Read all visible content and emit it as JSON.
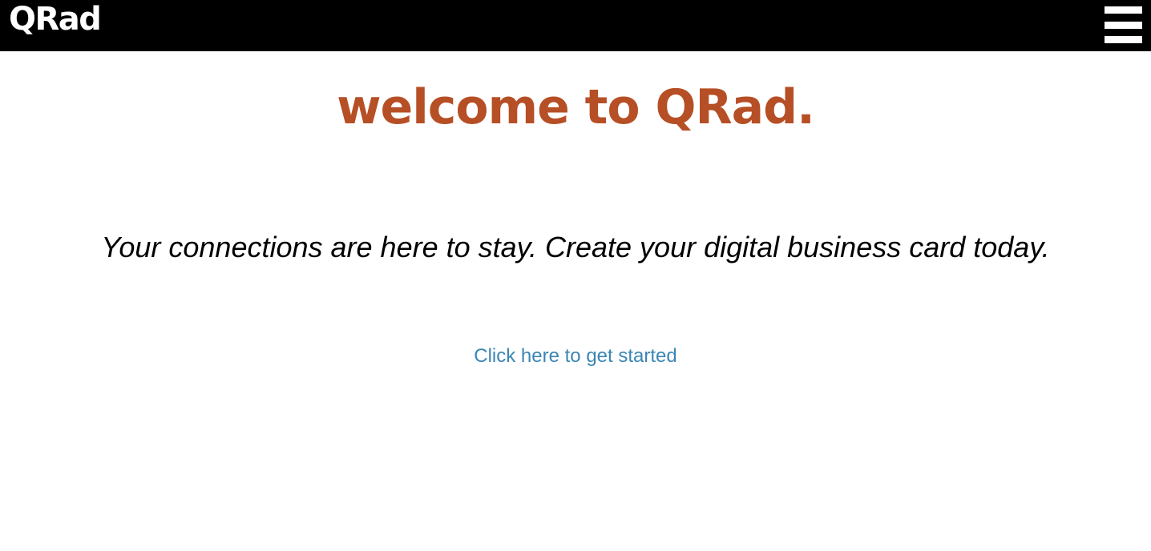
{
  "navbar": {
    "brand": "QRad",
    "menu_icon": "hamburger-menu-icon"
  },
  "hero": {
    "title": "welcome to QRad.",
    "tagline": "Your connections are here to stay. Create your digital business card today.",
    "cta_label": "Click here to get started"
  },
  "colors": {
    "navbar_bg": "#000000",
    "brand_text": "#ffffff",
    "title_accent": "#b64f25",
    "tagline_text": "#000000",
    "link": "#3a86b4",
    "page_bg": "#ffffff"
  }
}
